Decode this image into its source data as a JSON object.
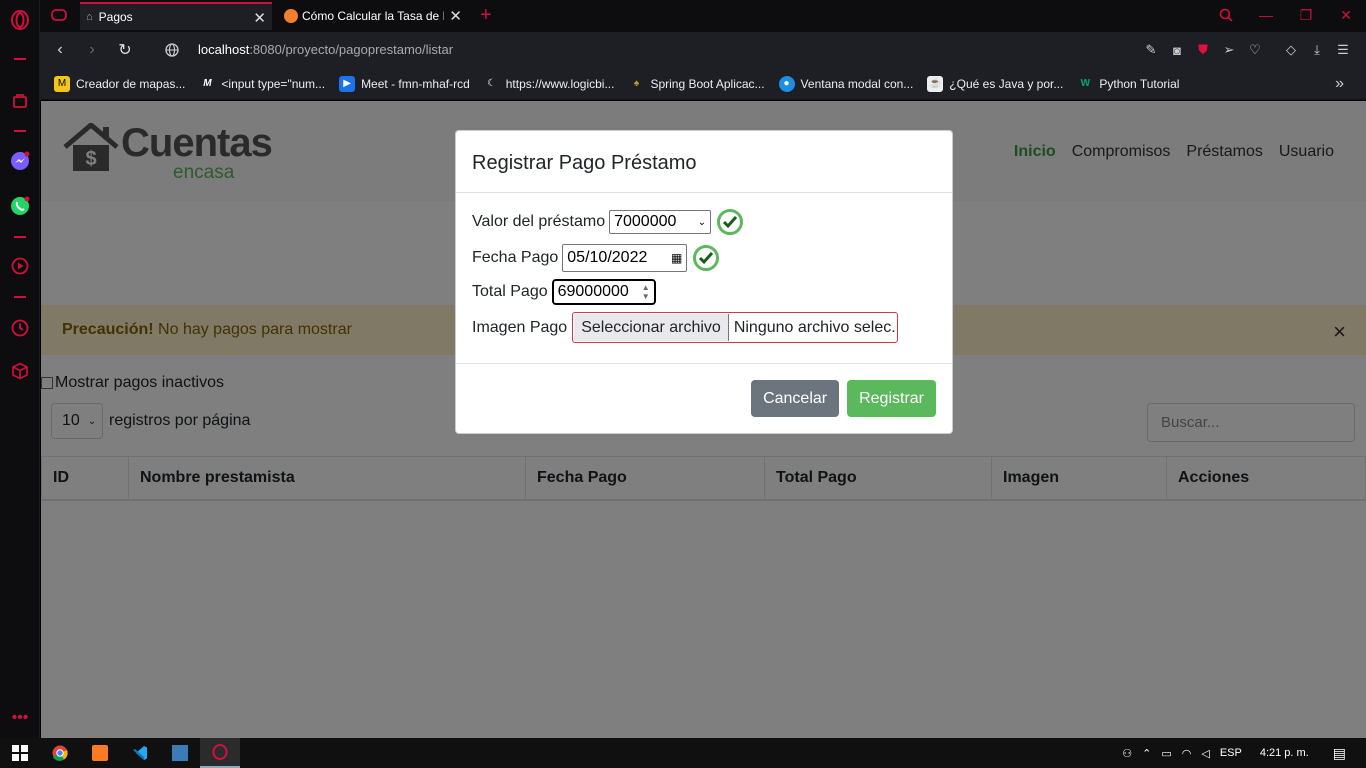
{
  "browser": {
    "tabs": [
      {
        "title": "Pagos",
        "active": true
      },
      {
        "title": "Cómo Calcular la Tasa de In",
        "active": false
      }
    ],
    "new_tab_icon": "plus-icon",
    "url_host": "localhost",
    "url_rest": ":8080/proyecto/pagoprestamo/listar",
    "bookmarks": [
      {
        "label": "Creador de mapas...",
        "icon": "miro-icon",
        "color": "#f5c518"
      },
      {
        "label": "<input type=\"num...",
        "icon": "m-icon",
        "color": "#333333"
      },
      {
        "label": "Meet - fmn-mhaf-rcd",
        "icon": "meet-icon",
        "color": "#1a73e8"
      },
      {
        "label": "https://www.logicbi...",
        "icon": "moon-icon",
        "color": "#444444"
      },
      {
        "label": "Spring Boot Aplicac...",
        "icon": "leaf-icon",
        "color": "#6cb33f"
      },
      {
        "label": "Ventana modal con...",
        "icon": "circle-icon",
        "color": "#1a8fe3"
      },
      {
        "label": "¿Qué es Java y por...",
        "icon": "java-icon",
        "color": "#e76f00"
      },
      {
        "label": "Python Tutorial",
        "icon": "w3-icon",
        "color": "#04aa6d"
      }
    ],
    "accent": "#d0103a"
  },
  "app": {
    "logo_main": "Cuentas",
    "logo_sub": "encasa",
    "nav": [
      {
        "label": "Inicio",
        "active": true
      },
      {
        "label": "Compromisos",
        "active": false
      },
      {
        "label": "Préstamos",
        "active": false
      },
      {
        "label": "Usuario",
        "active": false
      }
    ],
    "alert_strong": "Precaución!",
    "alert_text": " No hay pagos para mostrar",
    "show_inactive_label": "Mostrar pagos inactivos",
    "page_length": "10",
    "page_length_label": "registros por página",
    "search_placeholder": "Buscar...",
    "columns": [
      "ID",
      "Nombre prestamista",
      "Fecha Pago",
      "Total Pago",
      "Imagen",
      "Acciones"
    ]
  },
  "modal": {
    "title": "Registrar Pago Préstamo",
    "loan_label": "Valor del préstamo",
    "loan_value": "7000000",
    "date_label": "Fecha Pago",
    "date_value": "05/10/2022",
    "total_label": "Total Pago",
    "total_value": "69000000",
    "image_label": "Imagen Pago",
    "file_button": "Seleccionar archivo",
    "file_status": "Ninguno archivo selec.",
    "cancel": "Cancelar",
    "submit": "Registrar"
  },
  "taskbar": {
    "lang": "ESP",
    "time": "4:21 p. m."
  }
}
